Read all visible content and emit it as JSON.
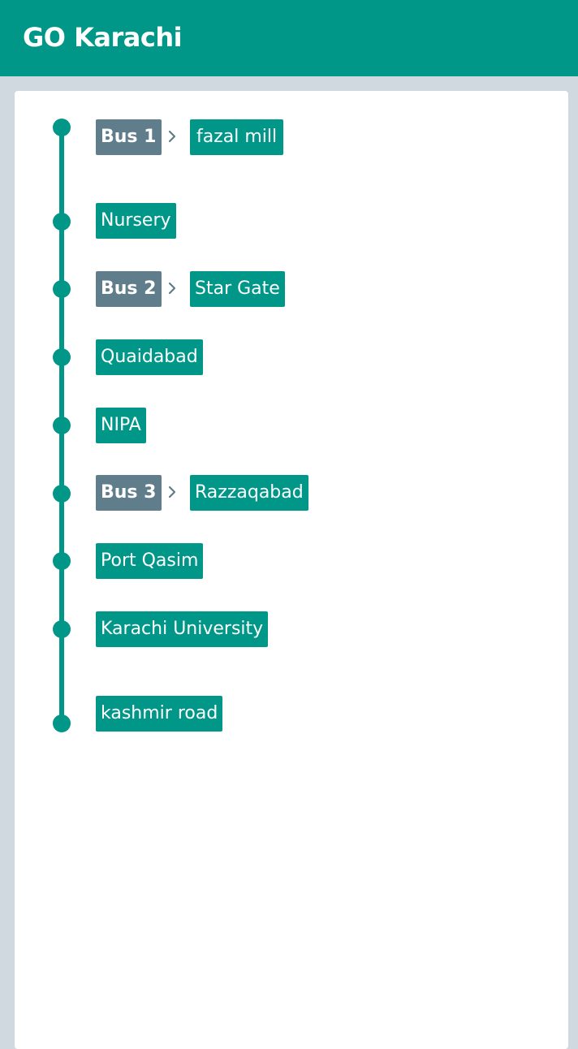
{
  "app": {
    "title": "GO Karachi"
  },
  "route": {
    "items": [
      {
        "bus": "Bus 1",
        "stop": "fazal mill"
      },
      {
        "bus": null,
        "stop": "Nursery"
      },
      {
        "bus": "Bus 2",
        "stop": "Star Gate"
      },
      {
        "bus": null,
        "stop": "Quaidabad"
      },
      {
        "bus": null,
        "stop": "NIPA"
      },
      {
        "bus": "Bus 3",
        "stop": "Razzaqabad"
      },
      {
        "bus": null,
        "stop": "Port Qasim"
      },
      {
        "bus": null,
        "stop": "Karachi University"
      },
      {
        "bus": null,
        "stop": "kashmir road"
      }
    ]
  },
  "colors": {
    "primary": "#009688",
    "bus_chip": "#607d8b",
    "background": "#d0d9df"
  },
  "icons": {
    "separator": "chevron-right-icon",
    "marker": "timeline-dot"
  }
}
